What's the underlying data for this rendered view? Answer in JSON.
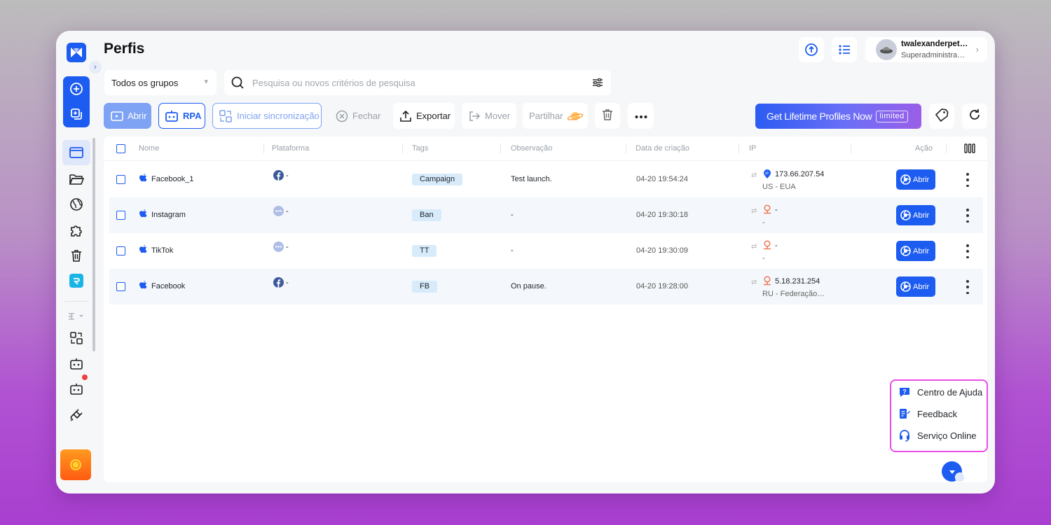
{
  "page": {
    "title": "Perfis"
  },
  "user": {
    "name": "twalexanderpet…",
    "role": "Superadministra…"
  },
  "filters": {
    "group_selected": "Todos os grupos",
    "search_placeholder": "Pesquisa ou novos critérios de pesquisa"
  },
  "toolbar": {
    "open_label": "Abrir",
    "rpa_label": "RPA",
    "sync_label": "Iniciar sincronização",
    "close_label": "Fechar",
    "export_label": "Exportar",
    "move_label": "Mover",
    "share_label": "Partilhar",
    "lifetime_label": "Get Lifetime Profiles Now",
    "lifetime_badge": "limited"
  },
  "table": {
    "columns": {
      "name": "Nome",
      "platform": "Plataforma",
      "tags": "Tags",
      "note": "Observação",
      "created": "Data de criação",
      "ip": "IP",
      "action": "Ação"
    },
    "rows": [
      {
        "name": "Facebook_1",
        "platform_icon": "facebook-icon",
        "platform": "-",
        "tag": "Campaign",
        "note": "Test launch.",
        "created": "04-20 19:54:24",
        "ip": "173.66.207.54",
        "location": "US - EUA",
        "ip_icon": "ip-pin-blue-icon",
        "action": "Abrir"
      },
      {
        "name": "Instagram",
        "platform_icon": "more-circle-icon",
        "platform": "-",
        "tag": "Ban",
        "note": "-",
        "created": "04-20 19:30:18",
        "ip": "-",
        "location": "-",
        "ip_icon": "location-pin-red-icon",
        "action": "Abrir"
      },
      {
        "name": "TikTok",
        "platform_icon": "more-circle-icon",
        "platform": "-",
        "tag": "TT",
        "note": "-",
        "created": "04-20 19:30:09",
        "ip": "-",
        "location": "-",
        "ip_icon": "location-pin-red-icon",
        "action": "Abrir"
      },
      {
        "name": "Facebook",
        "platform_icon": "facebook-icon",
        "platform": "-",
        "tag": "FB",
        "note": "On pause.",
        "created": "04-20 19:28:00",
        "ip": "5.18.231.254",
        "location": "RU - Federação…",
        "ip_icon": "location-pin-red-icon",
        "action": "Abrir"
      }
    ]
  },
  "help": {
    "center": "Centro de Ajuda",
    "feedback": "Feedback",
    "online": "Serviço Online"
  },
  "colors": {
    "accent": "#1d5cf0",
    "tag_bg": "#d7ebfb",
    "highlight_border": "#e94ee6"
  }
}
